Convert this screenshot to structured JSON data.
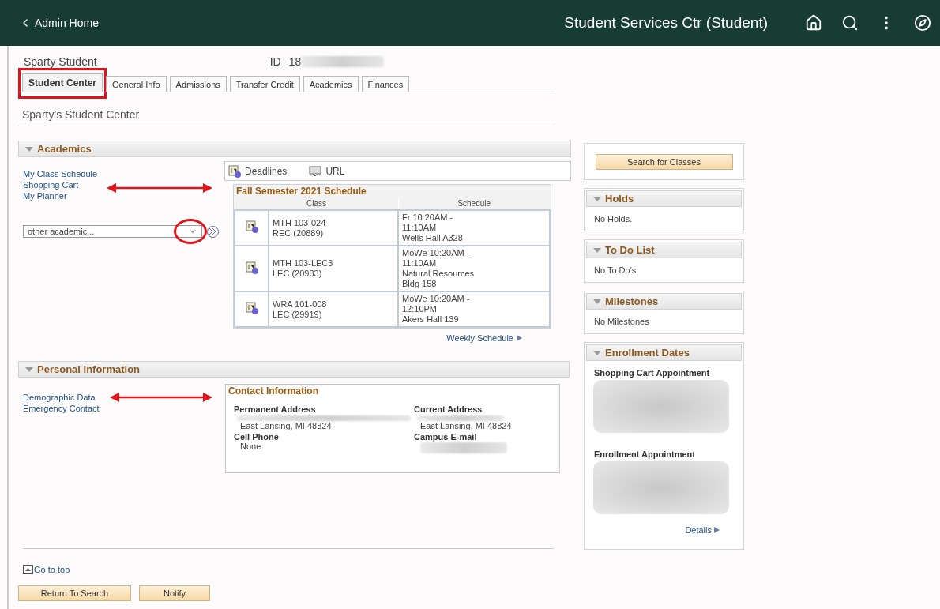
{
  "header": {
    "back": "Admin Home",
    "title": "Student Services Ctr (Student)"
  },
  "student": {
    "name": "Sparty Student",
    "id_label": "ID",
    "id_value": "18"
  },
  "tabs": [
    {
      "label": "Student Center",
      "selected": true
    },
    {
      "label": "General Info",
      "selected": false
    },
    {
      "label": "Admissions",
      "selected": false
    },
    {
      "label": "Transfer Credit",
      "selected": false
    },
    {
      "label": "Academics",
      "selected": false
    },
    {
      "label": "Finances",
      "selected": false
    }
  ],
  "page_title": "Sparty's Student Center",
  "academics": {
    "title": "Academics",
    "expanded": true,
    "links": [
      "My Class Schedule",
      "Shopping Cart",
      "My Planner"
    ],
    "dropdown": {
      "value": "other academic..."
    },
    "toolbar": [
      "Deadlines",
      "URL"
    ],
    "schedule": {
      "title": "Fall Semester 2021 Schedule",
      "columns": [
        "Class",
        "Schedule"
      ],
      "rows": [
        {
          "class": "MTH 103-024\nREC (20889)",
          "schedule": "Fr 10:20AM -\n11:10AM\nWells Hall A328"
        },
        {
          "class": "MTH 103-LEC3\nLEC (20933)",
          "schedule": "MoWe 10:20AM -\n11:10AM\nNatural Resources\nBldg 158"
        },
        {
          "class": "WRA 101-008\nLEC (29919)",
          "schedule": "MoWe 10:20AM -\n12:10PM\nAkers Hall 139"
        }
      ]
    },
    "weekly_link": "Weekly Schedule"
  },
  "personal": {
    "title": "Personal Information",
    "expanded": true,
    "links": [
      "Demographic Data",
      "Emergency Contact"
    ],
    "contact": {
      "title": "Contact Information",
      "fields": [
        {
          "label": "Permanent Address",
          "value": "East Lansing, MI 48824"
        },
        {
          "label": "Current Address",
          "value": "East Lansing, MI 48824"
        },
        {
          "label": "Cell Phone",
          "value": "None"
        },
        {
          "label": "Campus E-mail"
        }
      ]
    }
  },
  "sidebar": {
    "search_button": "Search for Classes",
    "panels": [
      {
        "title": "Holds",
        "expanded": true,
        "text": "No Holds."
      },
      {
        "title": "To Do List",
        "expanded": true,
        "text": "No To Do's."
      },
      {
        "title": "Milestones",
        "expanded": true,
        "text": "No Milestones"
      }
    ],
    "enrollment": {
      "title": "Enrollment Dates",
      "expanded": true,
      "items": [
        "Shopping Cart Appointment",
        "Enrollment Appointment"
      ],
      "details": "Details"
    }
  },
  "footer": {
    "go_to_top": "Go to top",
    "buttons": [
      "Return To Search",
      "Notify"
    ]
  }
}
